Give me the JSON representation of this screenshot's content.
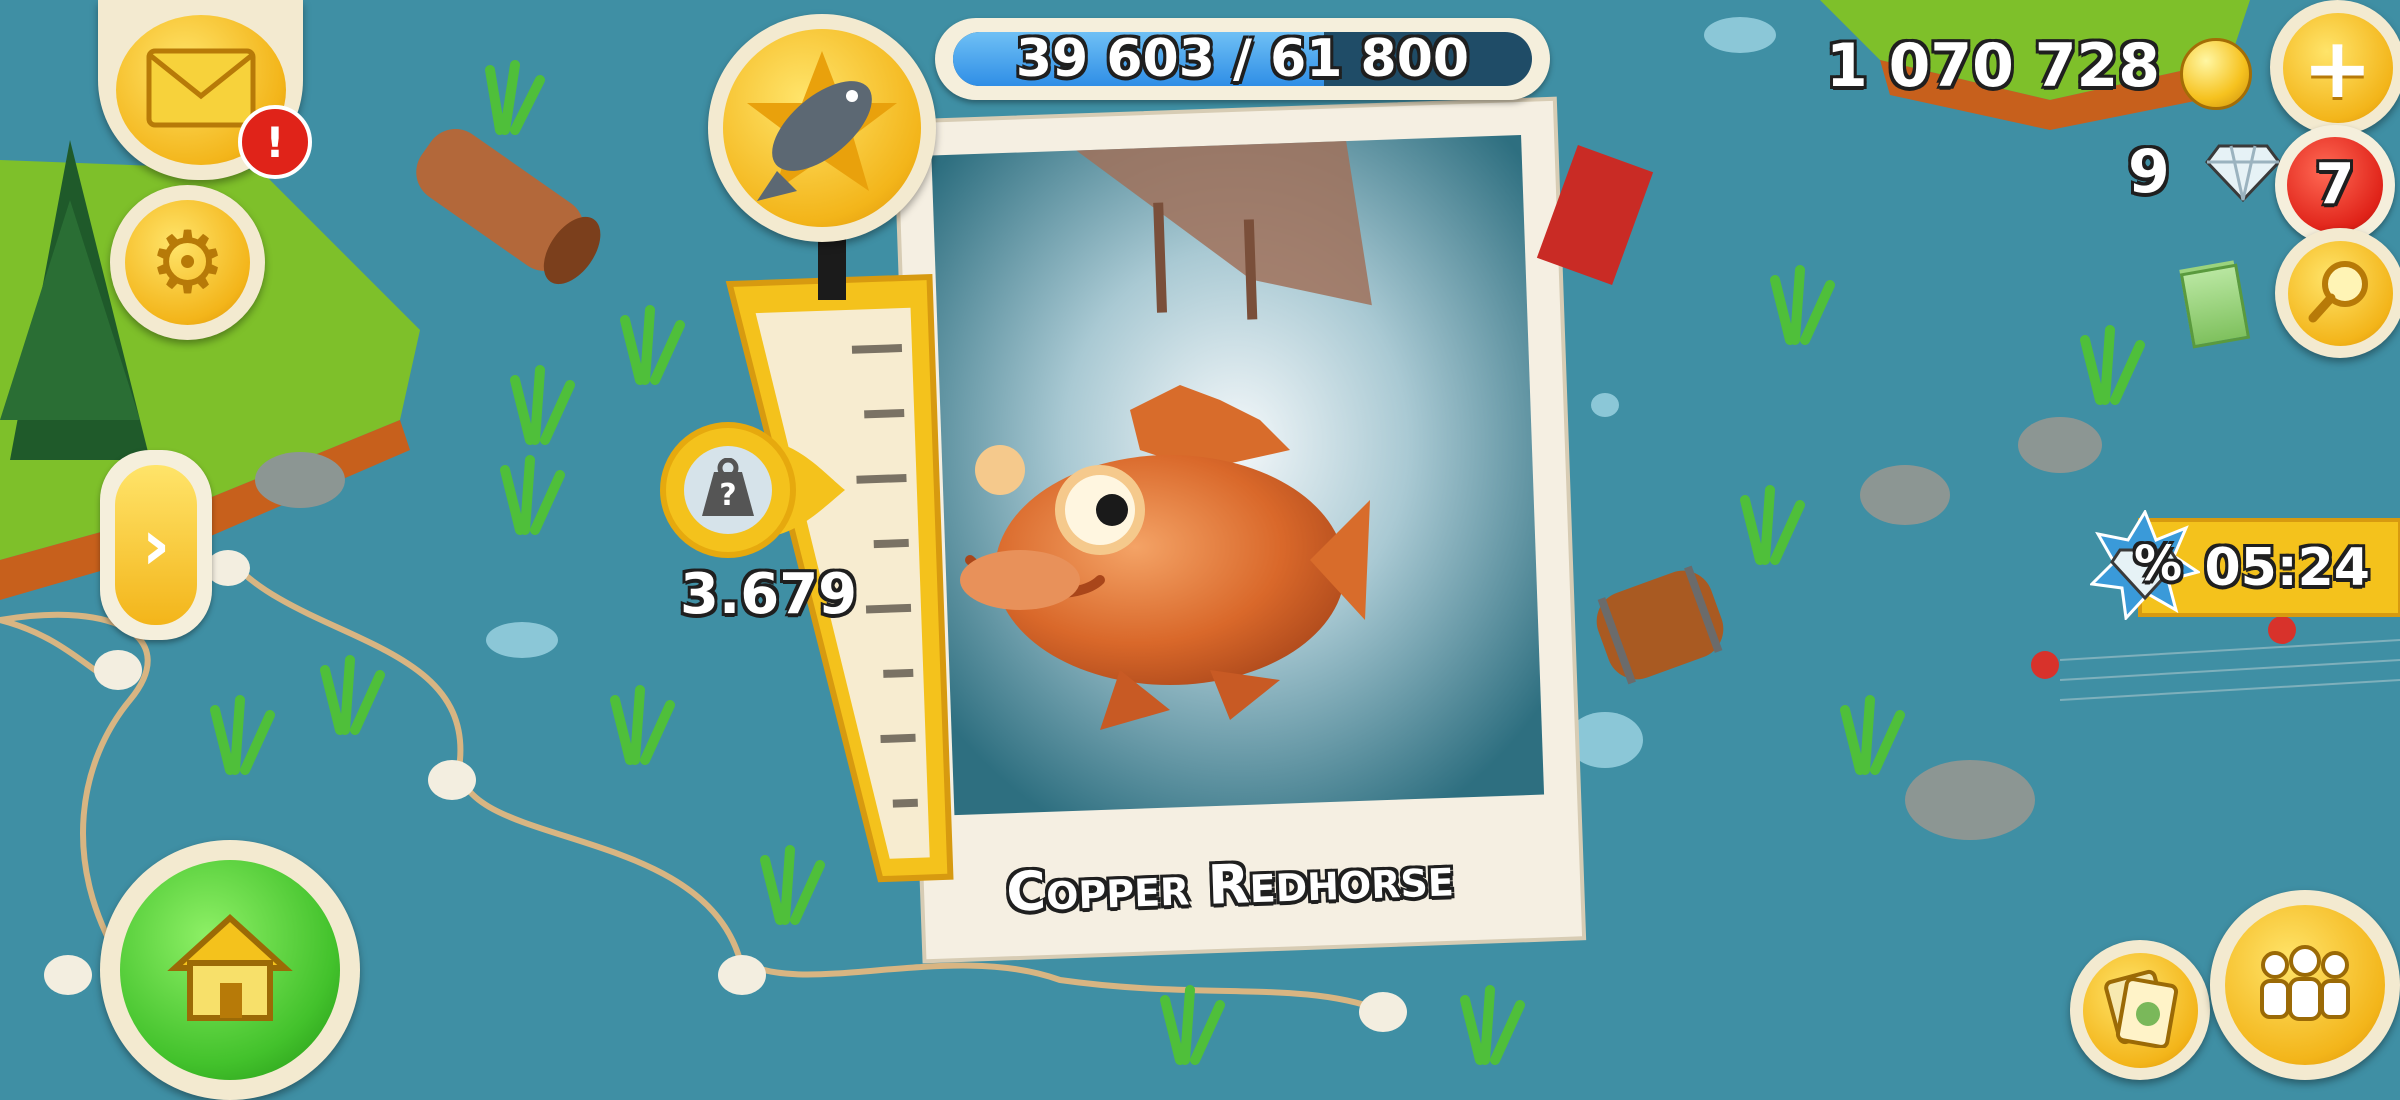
{
  "xp": {
    "text": "39 603 / 61 800",
    "current": 39603,
    "max": 61800
  },
  "currency": {
    "coins": "1 070 728",
    "diamonds": "9"
  },
  "notifications": {
    "mail_badge": "!",
    "diamond_badge": "7"
  },
  "sale": {
    "timer": "05:24",
    "icon_glyph": "%"
  },
  "catch": {
    "weight": "3.679",
    "weight_unknown_glyph": "?",
    "fish_name": "Copper Redhorse"
  },
  "icons": {
    "mail": "envelope-icon",
    "settings": "gear-icon",
    "expand": "chevron-right-icon",
    "home": "home-icon",
    "coin": "coin-icon",
    "diamond": "diamond-icon",
    "add": "plus-icon",
    "search": "magnifier-icon",
    "neighbors": "people-icon",
    "cards": "cards-icon",
    "fish_badge": "fish-star-icon",
    "weight": "weight-icon",
    "cash": "cash-icon"
  },
  "colors": {
    "water": "#3f8fa4",
    "accent_yellow": "#f6c21f",
    "home_green": "#43c22c",
    "badge_red": "#e02319",
    "xp_blue": "#2f8ee6",
    "fish_orange": "#e07b33"
  }
}
